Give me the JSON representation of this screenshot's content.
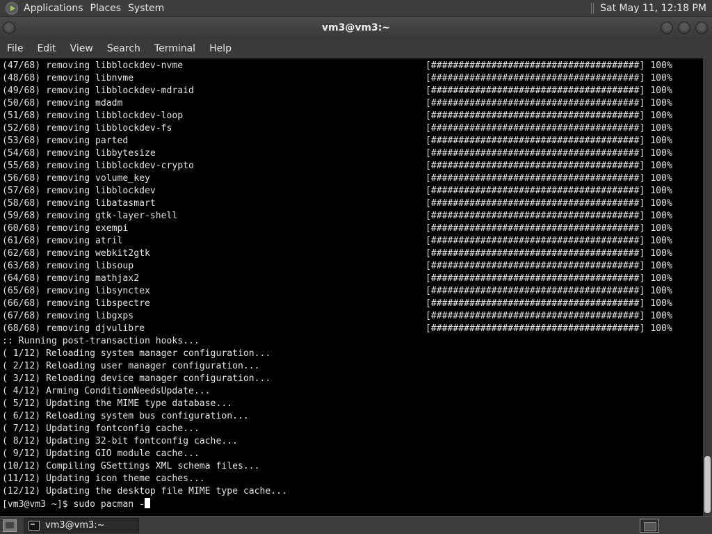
{
  "top_panel": {
    "menus": [
      "Applications",
      "Places",
      "System"
    ],
    "clock": "Sat May 11, 12:18 PM"
  },
  "window": {
    "title": "vm3@vm3:~",
    "menu": [
      "File",
      "Edit",
      "View",
      "Search",
      "Terminal",
      "Help"
    ]
  },
  "terminal": {
    "progress_bar": "[######################################]",
    "percent": "100%",
    "removals": [
      {
        "text": "(47/68) removing libblockdev-nvme"
      },
      {
        "text": "(48/68) removing libnvme"
      },
      {
        "text": "(49/68) removing libblockdev-mdraid"
      },
      {
        "text": "(50/68) removing mdadm"
      },
      {
        "text": "(51/68) removing libblockdev-loop"
      },
      {
        "text": "(52/68) removing libblockdev-fs"
      },
      {
        "text": "(53/68) removing parted"
      },
      {
        "text": "(54/68) removing libbytesize"
      },
      {
        "text": "(55/68) removing libblockdev-crypto"
      },
      {
        "text": "(56/68) removing volume_key"
      },
      {
        "text": "(57/68) removing libblockdev"
      },
      {
        "text": "(58/68) removing libatasmart"
      },
      {
        "text": "(59/68) removing gtk-layer-shell"
      },
      {
        "text": "(60/68) removing exempi"
      },
      {
        "text": "(61/68) removing atril"
      },
      {
        "text": "(62/68) removing webkit2gtk"
      },
      {
        "text": "(63/68) removing libsoup"
      },
      {
        "text": "(64/68) removing mathjax2"
      },
      {
        "text": "(65/68) removing libsynctex"
      },
      {
        "text": "(66/68) removing libspectre"
      },
      {
        "text": "(67/68) removing libgxps"
      },
      {
        "text": "(68/68) removing djvulibre"
      }
    ],
    "hook_header": ":: Running post-transaction hooks...",
    "hooks": [
      "( 1/12) Reloading system manager configuration...",
      "( 2/12) Reloading user manager configuration...",
      "( 3/12) Reloading device manager configuration...",
      "( 4/12) Arming ConditionNeedsUpdate...",
      "( 5/12) Updating the MIME type database...",
      "( 6/12) Reloading system bus configuration...",
      "( 7/12) Updating fontconfig cache...",
      "( 8/12) Updating 32-bit fontconfig cache...",
      "( 9/12) Updating GIO module cache...",
      "(10/12) Compiling GSettings XML schema files...",
      "(11/12) Updating icon theme caches...",
      "(12/12) Updating the desktop file MIME type cache..."
    ],
    "prompt": "[vm3@vm3 ~]$ sudo pacman -"
  },
  "taskbar": {
    "task_label": "vm3@vm3:~"
  },
  "icons": {
    "logo": "mate-logo-icon",
    "window_menu": "window-menu-icon",
    "minimize": "minimize-icon",
    "maximize": "maximize-icon",
    "close": "close-icon",
    "show_desktop": "show-desktop-icon",
    "terminal": "terminal-icon",
    "workspace": "workspace-icon"
  },
  "colors": {
    "terminal_bg": "#000000",
    "terminal_fg": "#e2e2e2",
    "panel_bg": "#3c3c3c",
    "logo_accent": "#9ccf4b"
  }
}
